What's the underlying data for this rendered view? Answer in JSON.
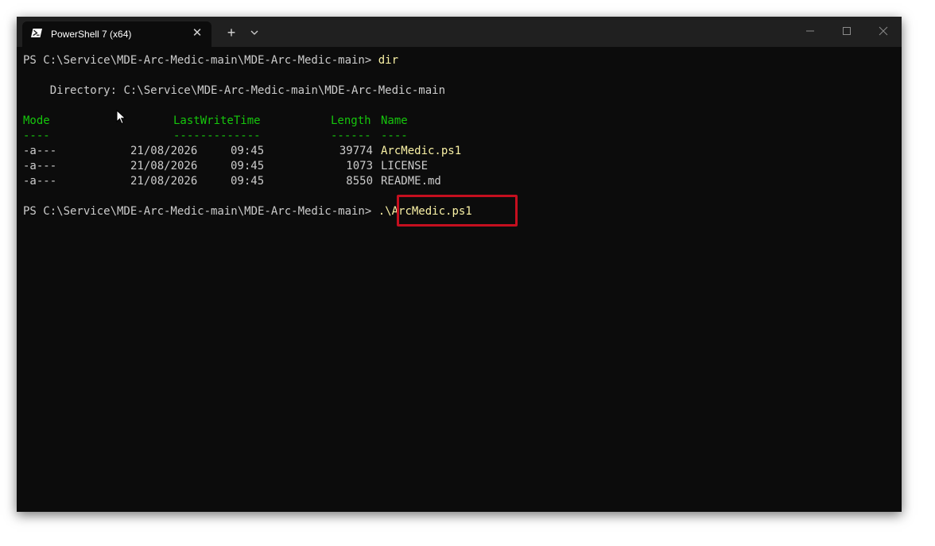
{
  "tab": {
    "title": "PowerShell 7 (x64)",
    "icon": "powershell-icon",
    "close": "✕"
  },
  "titlebar": {
    "new_tab": "+",
    "dropdown_icon": "chevron-down-icon",
    "minimize_icon": "minimize-icon",
    "maximize_icon": "maximize-icon",
    "close_icon": "close-icon"
  },
  "terminal": {
    "prompt": "PS C:\\Service\\MDE-Arc-Medic-main\\MDE-Arc-Medic-main> ",
    "first_command": "dir",
    "directory_label": "    Directory: ",
    "directory_path": "C:\\Service\\MDE-Arc-Medic-main\\MDE-Arc-Medic-main",
    "columns": {
      "mode": "Mode",
      "lastwritetime": "LastWriteTime",
      "length": "Length",
      "name": "Name"
    },
    "underlines": {
      "mode": "----",
      "lastwritetime": "-------------",
      "length": "------",
      "name": "----"
    },
    "rows": [
      {
        "mode": "-a---",
        "date": "21/08/2026",
        "time": "09:45",
        "length": "39774",
        "name": "ArcMedic.ps1"
      },
      {
        "mode": "-a---",
        "date": "21/08/2026",
        "time": "09:45",
        "length": "1073",
        "name": "LICENSE"
      },
      {
        "mode": "-a---",
        "date": "21/08/2026",
        "time": "09:45",
        "length": "8550",
        "name": "README.md"
      }
    ],
    "second_command": ".\\ArcMedic.ps1"
  },
  "colors": {
    "background": "#0c0c0c",
    "header_green": "#16c60c",
    "command_yellow": "#f9f1a5",
    "highlight_red": "#c50f1f"
  }
}
